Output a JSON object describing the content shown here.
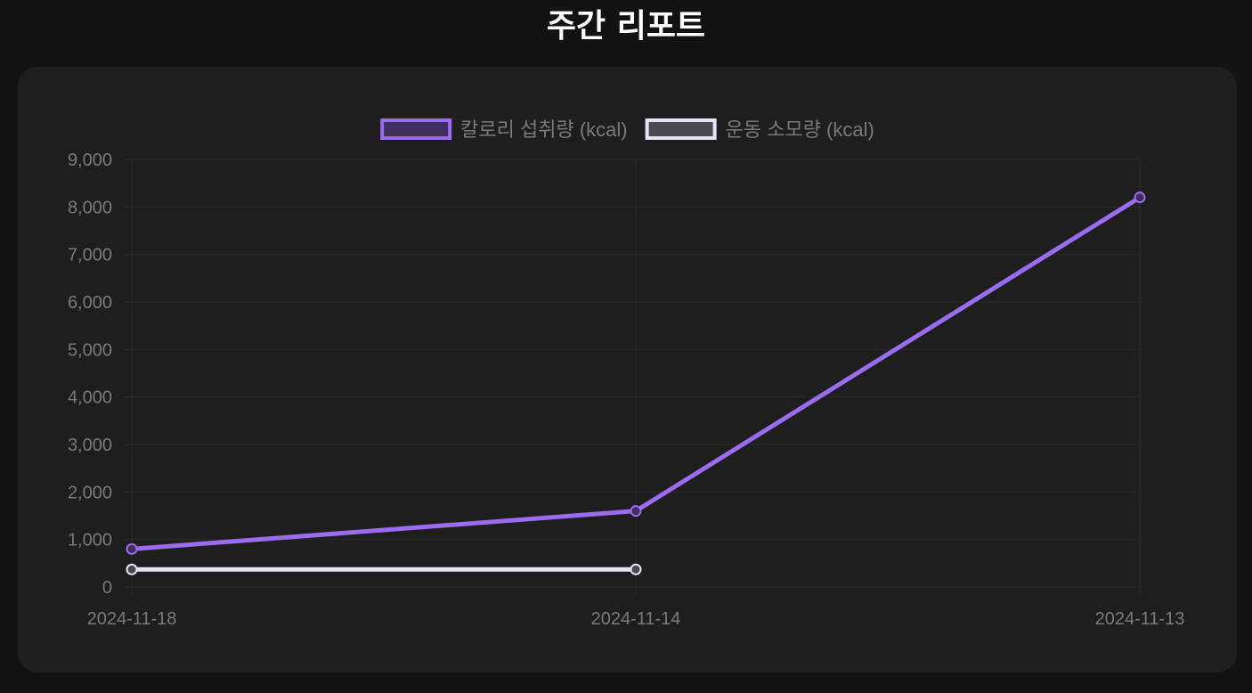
{
  "page": {
    "title": "주간 리포트"
  },
  "chart_data": {
    "type": "line",
    "title": "",
    "xlabel": "",
    "ylabel": "",
    "categories": [
      "2024-11-18",
      "2024-11-14",
      "2024-11-13"
    ],
    "ylim": [
      0,
      9000
    ],
    "yticks": [
      0,
      1000,
      2000,
      3000,
      4000,
      5000,
      6000,
      7000,
      8000,
      9000
    ],
    "grid": true,
    "legend_position": "top",
    "series": [
      {
        "name": "칼로리 섭취량 (kcal)",
        "values": [
          800,
          1600,
          8200
        ],
        "color": "#9b6cf0",
        "fill": "#3e2f5e"
      },
      {
        "name": "운동 소모량 (kcal)",
        "values": [
          370,
          370,
          null
        ],
        "color": "#e8e4f8",
        "fill": "#4a4a50"
      }
    ]
  }
}
